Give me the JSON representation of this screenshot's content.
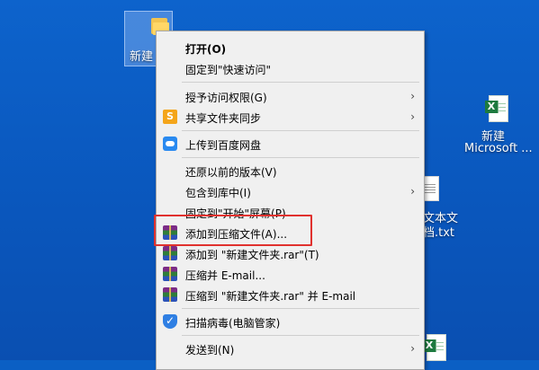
{
  "desktop": {
    "folder_label": "新建",
    "excel_label_1": "新建",
    "excel_label_2": "Microsoft ...",
    "txt_label_1": "文本文",
    "txt_label_2": "档.txt"
  },
  "icons": {
    "folder": "folder-icon",
    "excel": "excel-file-icon",
    "text": "text-file-icon",
    "share_sync": "share-sync-icon",
    "baidu_cloud": "baidu-cloud-icon",
    "winrar": "winrar-icon",
    "shield": "security-shield-icon"
  },
  "menu": {
    "items": [
      {
        "label": "打开(O)",
        "bold": true
      },
      {
        "label": "固定到\"快速访问\""
      },
      {
        "label": "授予访问权限(G)",
        "submenu": true
      },
      {
        "label": "共享文件夹同步",
        "submenu": true
      },
      {
        "label": "上传到百度网盘"
      },
      {
        "label": "还原以前的版本(V)"
      },
      {
        "label": "包含到库中(I)",
        "submenu": true
      },
      {
        "label": "固定到\"开始\"屏幕(P)"
      },
      {
        "label": "添加到压缩文件(A)..."
      },
      {
        "label": "添加到 \"新建文件夹.rar\"(T)"
      },
      {
        "label": "压缩并 E-mail..."
      },
      {
        "label": "压缩到 \"新建文件夹.rar\" 并 E-mail"
      },
      {
        "label": "扫描病毒(电脑管家)"
      },
      {
        "label": "发送到(N)",
        "submenu": true
      }
    ],
    "arrow": "›"
  },
  "colors": {
    "desktop": "#0b5fc4",
    "menu_bg": "#f0f0f0",
    "highlight_border": "#e0312e"
  }
}
